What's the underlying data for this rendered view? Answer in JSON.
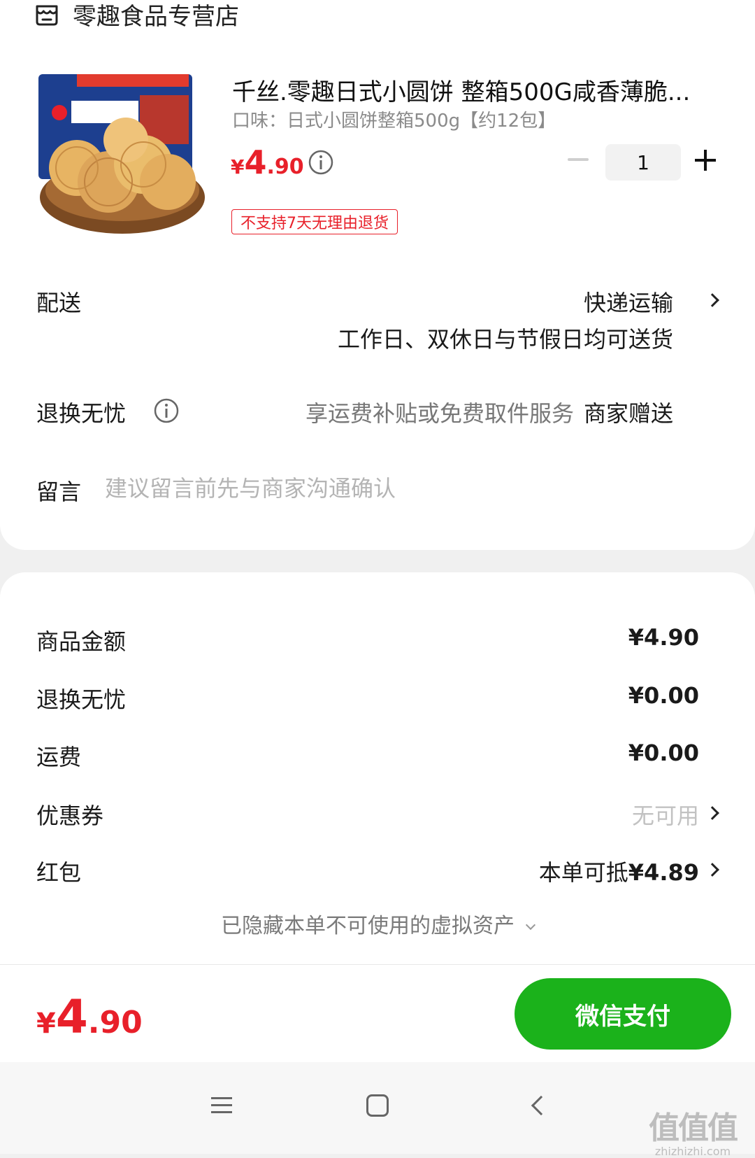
{
  "store": {
    "name": "零趣食品专营店",
    "icon": "store-icon"
  },
  "product": {
    "title": "千丝.零趣日式小圆饼 整箱500G咸香薄脆...",
    "variant": "口味：日式小圆饼整箱500g【约12包】",
    "price_yen": "¥",
    "price_int": "4",
    "price_dec": ".90",
    "quantity": "1",
    "return_tag": "不支持7天无理由退货",
    "image_icon": "biscuit-product-image"
  },
  "delivery": {
    "label": "配送",
    "value": "快递运输",
    "subtext": "工作日、双休日与节假日均可送货"
  },
  "exchange": {
    "label": "退换无忧",
    "description": "享运费补贴或免费取件服务",
    "provider": "商家赠送"
  },
  "note": {
    "label": "留言",
    "placeholder": "建议留言前先与商家沟通确认"
  },
  "summary": {
    "goods_amount_label": "商品金额",
    "goods_amount": "¥4.90",
    "exchange_label": "退换无忧",
    "exchange_amount": "¥0.00",
    "shipping_label": "运费",
    "shipping_amount": "¥0.00",
    "coupon_label": "优惠券",
    "coupon_value": "无可用",
    "redpacket_label": "红包",
    "redpacket_prefix": "本单可抵",
    "redpacket_amount": "¥4.89",
    "hidden_assets": "已隐藏本单不可使用的虚拟资产"
  },
  "footer": {
    "total_yen": "¥",
    "total_int": "4",
    "total_dec": ".90",
    "pay_label": "微信支付"
  },
  "watermark": {
    "chars": "值值值",
    "url": "zhizhizhi.com"
  },
  "colors": {
    "price_red": "#e8202a",
    "pay_green": "#1bb21b"
  }
}
